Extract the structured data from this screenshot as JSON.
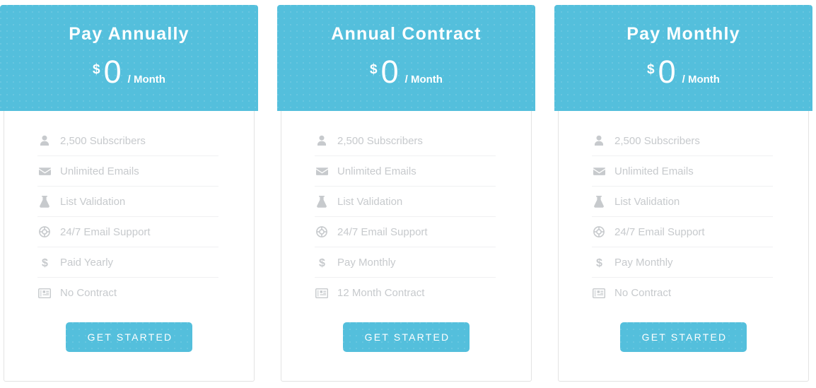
{
  "plans": [
    {
      "title": "Pay Annually",
      "currency": "$",
      "amount": "0",
      "period": "/ Month",
      "features": [
        {
          "icon": "user-icon",
          "label": "2,500 Subscribers"
        },
        {
          "icon": "envelope-icon",
          "label": "Unlimited Emails"
        },
        {
          "icon": "flask-icon",
          "label": "List Validation"
        },
        {
          "icon": "life-ring-icon",
          "label": "24/7 Email Support"
        },
        {
          "icon": "dollar-sign-icon",
          "label": "Paid Yearly"
        },
        {
          "icon": "id-card-icon",
          "label": "No Contract"
        }
      ],
      "cta_label": "GET STARTED"
    },
    {
      "title": "Annual Contract",
      "currency": "$",
      "amount": "0",
      "period": "/ Month",
      "features": [
        {
          "icon": "user-icon",
          "label": "2,500 Subscribers"
        },
        {
          "icon": "envelope-icon",
          "label": "Unlimited Emails"
        },
        {
          "icon": "flask-icon",
          "label": "List Validation"
        },
        {
          "icon": "life-ring-icon",
          "label": "24/7 Email Support"
        },
        {
          "icon": "dollar-sign-icon",
          "label": "Pay Monthly"
        },
        {
          "icon": "id-card-icon",
          "label": "12 Month Contract"
        }
      ],
      "cta_label": "GET STARTED"
    },
    {
      "title": "Pay Monthly",
      "currency": "$",
      "amount": "0",
      "period": "/ Month",
      "features": [
        {
          "icon": "user-icon",
          "label": "2,500 Subscribers"
        },
        {
          "icon": "envelope-icon",
          "label": "Unlimited Emails"
        },
        {
          "icon": "flask-icon",
          "label": "List Validation"
        },
        {
          "icon": "life-ring-icon",
          "label": "24/7 Email Support"
        },
        {
          "icon": "dollar-sign-icon",
          "label": "Pay Monthly"
        },
        {
          "icon": "id-card-icon",
          "label": "No Contract"
        }
      ],
      "cta_label": "GET STARTED"
    }
  ],
  "colors": {
    "accent": "#54bfdc",
    "header_text": "#ffffff",
    "feature_text": "#c7cacd",
    "card_border": "#e3e3e3",
    "divider": "#f0f1f2"
  }
}
